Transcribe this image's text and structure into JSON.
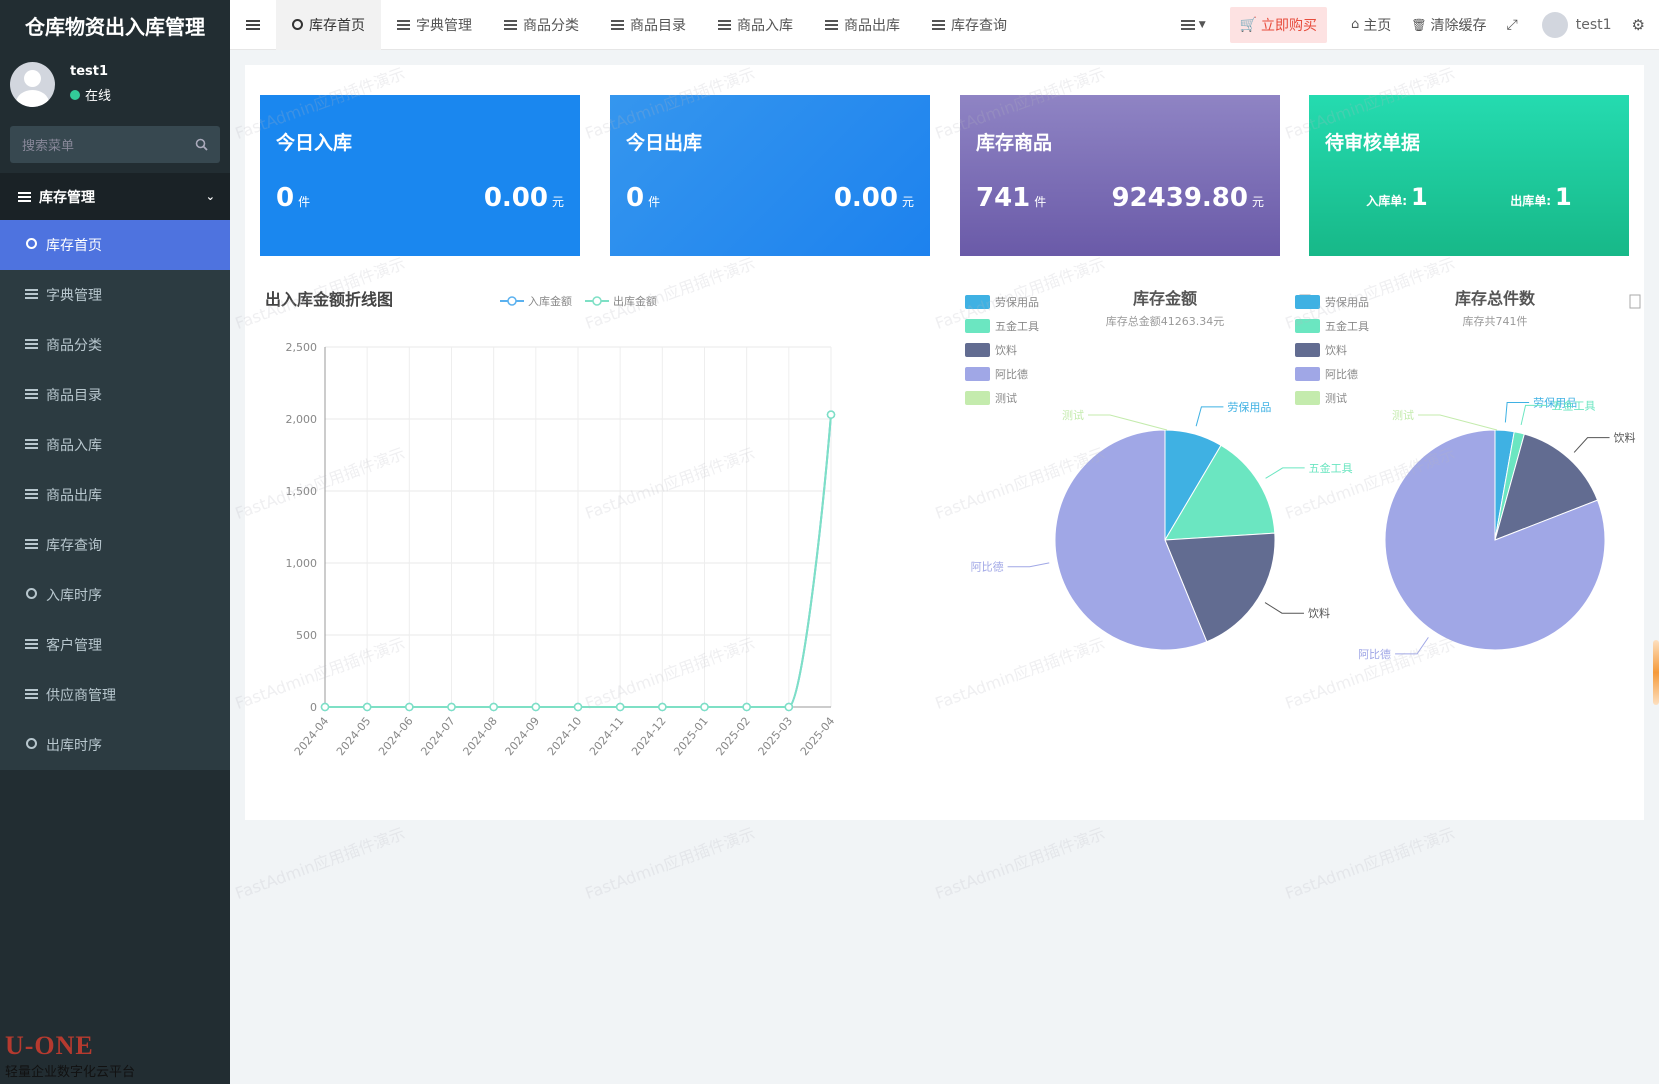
{
  "app": {
    "title": "仓库物资出入库管理"
  },
  "user": {
    "name": "test1",
    "status": "在线"
  },
  "search": {
    "placeholder": "搜索菜单"
  },
  "sidebar": {
    "group_label": "库存管理",
    "items": [
      {
        "label": "库存首页",
        "icon": "circle-icon",
        "active": true
      },
      {
        "label": "字典管理",
        "icon": "list-icon"
      },
      {
        "label": "商品分类",
        "icon": "list-icon"
      },
      {
        "label": "商品目录",
        "icon": "list-icon"
      },
      {
        "label": "商品入库",
        "icon": "list-icon"
      },
      {
        "label": "商品出库",
        "icon": "list-icon"
      },
      {
        "label": "库存查询",
        "icon": "list-icon"
      },
      {
        "label": "入库时序",
        "icon": "circle-icon"
      },
      {
        "label": "客户管理",
        "icon": "list-icon"
      },
      {
        "label": "供应商管理",
        "icon": "list-icon"
      },
      {
        "label": "出库时序",
        "icon": "circle-icon"
      }
    ]
  },
  "topbar": {
    "tabs": [
      {
        "label": "库存首页",
        "active": true
      },
      {
        "label": "字典管理"
      },
      {
        "label": "商品分类"
      },
      {
        "label": "商品目录"
      },
      {
        "label": "商品入库"
      },
      {
        "label": "商品出库"
      },
      {
        "label": "库存查询"
      }
    ],
    "buy_label": "立即购买",
    "home_label": "主页",
    "clear_cache_label": "清除缓存",
    "user_name": "test1"
  },
  "cards": {
    "in_today": {
      "title": "今日入库",
      "count": "0",
      "count_unit": "件",
      "amount": "0.00",
      "amount_unit": "元",
      "color": "#1a87ef"
    },
    "out_today": {
      "title": "今日出库",
      "count": "0",
      "count_unit": "件",
      "amount": "0.00",
      "amount_unit": "元",
      "color": "#2290ee"
    },
    "stock": {
      "title": "库存商品",
      "count": "741",
      "count_unit": "件",
      "amount": "92439.80",
      "amount_unit": "元",
      "color": "#7b6fb5"
    },
    "pending": {
      "title": "待审核单据",
      "in_label": "入库单:",
      "in_value": "1",
      "out_label": "出库单:",
      "out_value": "1",
      "color": "#1fd0a0"
    }
  },
  "brand": {
    "logo_text": "U-ONE",
    "subtitle": "轻量企业数字化云平台"
  },
  "watermark_text": "FastAdmin应用插件演示",
  "chart_data": [
    {
      "type": "line",
      "title": "出入库金额折线图",
      "x": [
        "2024-04",
        "2024-05",
        "2024-06",
        "2024-07",
        "2024-08",
        "2024-09",
        "2024-10",
        "2024-11",
        "2024-12",
        "2025-01",
        "2025-02",
        "2025-03",
        "2025-04"
      ],
      "series": [
        {
          "name": "入库金额",
          "color": "#5ab1ef",
          "values": [
            0,
            0,
            0,
            0,
            0,
            0,
            0,
            0,
            0,
            0,
            0,
            0,
            2030
          ]
        },
        {
          "name": "出库金额",
          "color": "#7ee0c5",
          "values": [
            0,
            0,
            0,
            0,
            0,
            0,
            0,
            0,
            0,
            0,
            0,
            0,
            2030
          ]
        }
      ],
      "ylim": [
        0,
        2500
      ],
      "yticks": [
        "0",
        "500",
        "1,000",
        "1,500",
        "2,000",
        "2,500"
      ],
      "grid": true,
      "legend": "top"
    },
    {
      "type": "pie",
      "title": "库存金额",
      "subtitle": "库存总金额41263.34元",
      "categories": [
        "劳保用品",
        "五金工具",
        "饮料",
        "阿比德",
        "测试"
      ],
      "colors": [
        "#3fb1e3",
        "#6be6c1",
        "#626c91",
        "#a0a7e6",
        "#c4ebad"
      ],
      "values": [
        8.5,
        15.5,
        19.8,
        56.2,
        0
      ]
    },
    {
      "type": "pie",
      "title": "库存总件数",
      "subtitle": "库存共741件",
      "categories": [
        "劳保用品",
        "五金工具",
        "饮料",
        "阿比德",
        "测试"
      ],
      "colors": [
        "#3fb1e3",
        "#6be6c1",
        "#626c91",
        "#a0a7e6",
        "#c4ebad"
      ],
      "values": [
        2.8,
        1.5,
        14.8,
        80.9,
        0
      ]
    }
  ]
}
